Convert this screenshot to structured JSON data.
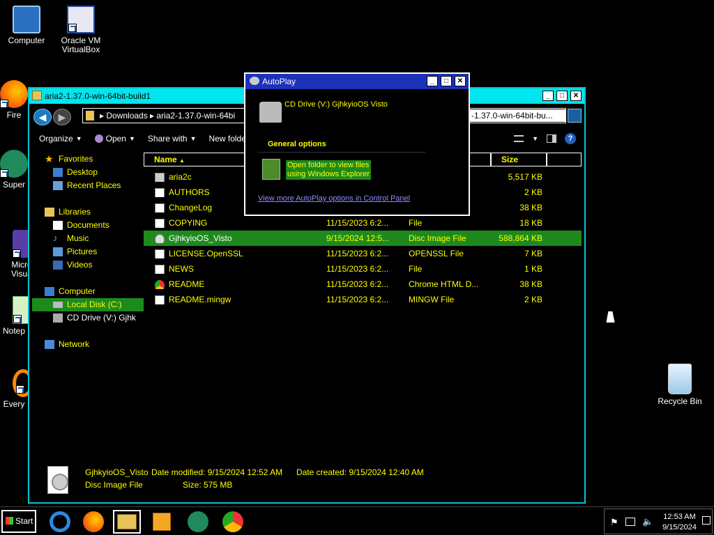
{
  "desktop": {
    "icons": [
      {
        "label": "Computer"
      },
      {
        "label": "Oracle VM VirtualBox"
      },
      {
        "label": "Fire"
      },
      {
        "label": "Super"
      },
      {
        "label": "Micro Visual"
      },
      {
        "label": "Notep"
      },
      {
        "label": "Every"
      },
      {
        "label": "Recycle Bin"
      }
    ]
  },
  "explorer": {
    "title": "aria2-1.37.0-win-64bit-build1",
    "address": "▸ Downloads ▸ aria2-1.37.0-win-64bi",
    "address_tail": "-1.37.0-win-64bit-bu...",
    "toolbar": {
      "organize": "Organize",
      "open": "Open",
      "share": "Share with",
      "new_folder": "New folde"
    },
    "nav": {
      "favorites": "Favorites",
      "desktop": "Desktop",
      "recent": "Recent Places",
      "libraries": "Libraries",
      "documents": "Documents",
      "music": "Music",
      "pictures": "Pictures",
      "videos": "Videos",
      "computer": "Computer",
      "local_disk": "Local Disk (C:)",
      "cd_drive": "CD Drive (V:) Gjhk",
      "network": "Network"
    },
    "columns": {
      "name": "Name",
      "size": "Size"
    },
    "files": [
      {
        "name": "aria2c",
        "date": "",
        "type": "",
        "size": "5,517 KB"
      },
      {
        "name": "AUTHORS",
        "date": "",
        "type": "",
        "size": "2 KB"
      },
      {
        "name": "ChangeLog",
        "date": "",
        "type": "",
        "size": "38 KB"
      },
      {
        "name": "COPYING",
        "date": "11/15/2023 6:2...",
        "type": "File",
        "size": "18 KB"
      },
      {
        "name": "GjhkyioOS_Visto",
        "date": "9/15/2024 12:5...",
        "type": "Disc Image File",
        "size": "588,864 KB"
      },
      {
        "name": "LICENSE.OpenSSL",
        "date": "11/15/2023 6:2...",
        "type": "OPENSSL File",
        "size": "7 KB"
      },
      {
        "name": "NEWS",
        "date": "11/15/2023 6:2...",
        "type": "File",
        "size": "1 KB"
      },
      {
        "name": "README",
        "date": "11/15/2023 6:2...",
        "type": "Chrome HTML D...",
        "size": "38 KB"
      },
      {
        "name": "README.mingw",
        "date": "11/15/2023 6:2...",
        "type": "MINGW File",
        "size": "2 KB"
      }
    ],
    "details": {
      "name": "GjhkyioOS_Visto",
      "type": "Disc Image File",
      "modified": "Date modified: 9/15/2024 12:52 AM",
      "created": "Date created: 9/15/2024 12:40 AM",
      "size": "Size: 575 MB"
    }
  },
  "autoplay": {
    "title": "AutoPlay",
    "drive": "CD Drive (V:) GjhkyioOS Visto",
    "section": "General options",
    "option_line1": "Open folder to view files",
    "option_line2": "using Windows Explorer",
    "link": "View more AutoPlay options in Control Panel"
  },
  "taskbar": {
    "start": "Start",
    "time": "12:53 AM",
    "date": "9/15/2024"
  }
}
